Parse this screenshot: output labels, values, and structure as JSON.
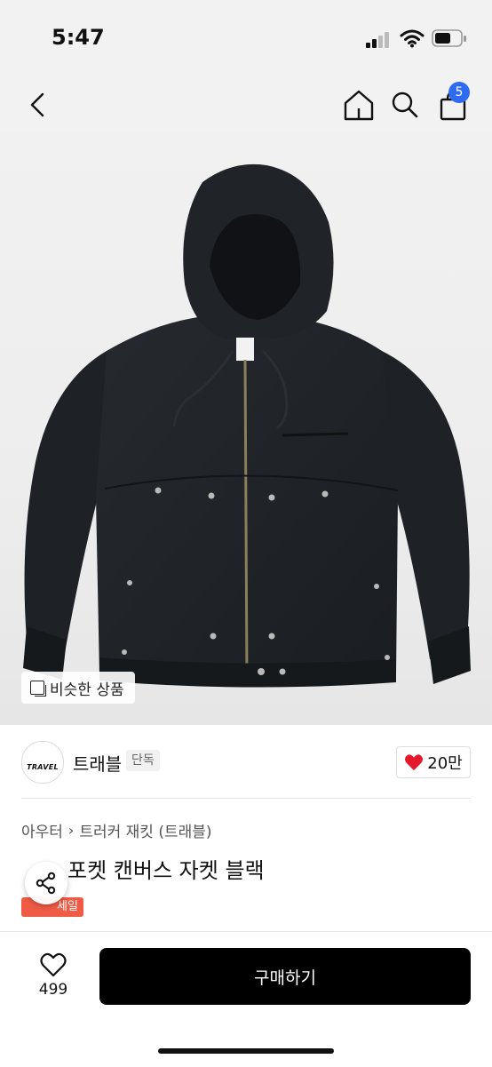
{
  "status": {
    "time": "5:47"
  },
  "header": {
    "cart_count": "5"
  },
  "gallery": {
    "similar_label": "비슷한 상품"
  },
  "brand": {
    "logo_text": "TRAVEL",
    "name": "트래블",
    "exclusive_label": "단독",
    "likes": "20만"
  },
  "breadcrumb": {
    "category": "아우터",
    "subcategory": "트러커 재킷 (트래블)"
  },
  "product": {
    "title_visible": "포켓 캔버스 자켓 블랙",
    "sale_badge_visible": "세일"
  },
  "bottom_bar": {
    "wish_count": "499",
    "buy_label": "구매하기"
  },
  "colors": {
    "accent_badge": "#2f6bf0",
    "sale": "#ef5b45",
    "heart": "#e5192b",
    "buy_button": "#000000"
  }
}
